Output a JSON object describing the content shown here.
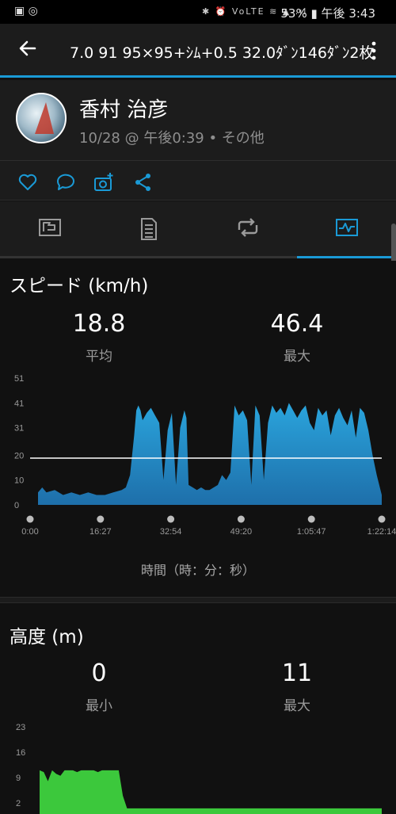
{
  "status_bar": {
    "left_icons": "▣ ◎",
    "right_icons": "✱ ⏰ VoLTE ≋ ▲ .ıl",
    "battery": "53%",
    "time": "午後 3:43"
  },
  "app_bar": {
    "title": "7.0 91 95×95+ｼﾑ+0.5 32.0ﾀﾞﾝ146ﾀﾞﾝ2枚"
  },
  "profile": {
    "name": "香村 治彦",
    "meta": "10/28 @ 午後0:39 • その他"
  },
  "icons": {
    "back": "arrow-left",
    "more": "more-vertical",
    "like": "heart",
    "comment": "speech-bubble",
    "photo": "camera-plus",
    "share": "share",
    "tabs": [
      "summary-flag",
      "document-list",
      "repeat-laps",
      "chart-pulse"
    ]
  },
  "colors": {
    "accent": "#1a9ad6",
    "speed_fill_top": "#2aa4dc",
    "speed_fill_bottom": "#1e6faa",
    "elevation_fill": "#3cc83c",
    "avg_line": "#ffffff"
  },
  "speed": {
    "title": "スピード (km/h)",
    "avg_value": "18.8",
    "avg_label": "平均",
    "max_value": "46.4",
    "max_label": "最大",
    "axis_caption": "時間（時：分：秒）"
  },
  "elevation": {
    "title": "高度 (m)",
    "min_value": "0",
    "min_label": "最小",
    "max_value": "11",
    "max_label": "最大"
  },
  "chart_data": [
    {
      "type": "area",
      "title": "スピード (km/h)",
      "xlabel": "時間（時：分：秒）",
      "ylabel": "",
      "y_ticks": [
        "51",
        "41",
        "31",
        "20",
        "10",
        "0"
      ],
      "x_ticks": [
        "0:00",
        "16:27",
        "32:54",
        "49:20",
        "1:05:47",
        "1:22:14"
      ],
      "ylim": [
        0,
        51
      ],
      "average_line": 18.8,
      "series": [
        {
          "x_minutes": [
            0,
            1,
            2,
            4,
            6,
            8,
            10,
            12,
            14,
            16,
            18,
            20,
            21,
            22,
            23,
            23.5,
            24,
            24.5,
            25,
            26,
            27,
            28,
            29,
            30,
            31,
            32,
            33,
            34,
            35,
            35.5,
            36,
            37,
            38,
            39,
            40,
            41,
            42,
            43,
            44,
            45,
            46,
            47,
            48,
            49,
            50,
            51,
            52,
            53,
            54,
            55,
            56,
            57,
            58,
            59,
            60,
            61,
            62,
            63,
            64,
            65,
            66,
            67,
            68,
            69,
            70,
            71,
            72,
            73,
            74,
            75,
            76,
            77,
            78,
            79,
            80,
            81,
            82.2
          ],
          "values": [
            5,
            7,
            5,
            6,
            4,
            5,
            4,
            5,
            4,
            4,
            5,
            6,
            7,
            12,
            28,
            38,
            40,
            38,
            34,
            37,
            39,
            36,
            33,
            10,
            30,
            37,
            8,
            31,
            38,
            35,
            8,
            7,
            6,
            7,
            6,
            6,
            7,
            8,
            12,
            10,
            13,
            40,
            36,
            38,
            34,
            8,
            40,
            36,
            10,
            33,
            40,
            37,
            39,
            36,
            41,
            38,
            35,
            38,
            40,
            33,
            30,
            39,
            36,
            38,
            28,
            36,
            39,
            35,
            32,
            38,
            27,
            39,
            37,
            30,
            20,
            12,
            4
          ]
        }
      ]
    },
    {
      "type": "area",
      "title": "高度 (m)",
      "xlabel": "",
      "ylabel": "",
      "y_ticks": [
        "23",
        "16",
        "9",
        "2"
      ],
      "ylim": [
        0,
        23
      ],
      "series": [
        {
          "x_minutes": [
            0,
            1,
            2,
            3,
            4,
            5,
            6,
            7,
            8,
            9,
            10,
            11,
            12,
            13,
            14,
            15,
            16,
            17,
            18,
            19,
            20,
            21,
            22,
            82.2
          ],
          "values": [
            11,
            10.5,
            8,
            11,
            10,
            9.5,
            11,
            11,
            11,
            10.5,
            11,
            11,
            11,
            11,
            10.5,
            11,
            11,
            11,
            11,
            11,
            4,
            0.5,
            0.5,
            0.5
          ]
        }
      ]
    }
  ]
}
